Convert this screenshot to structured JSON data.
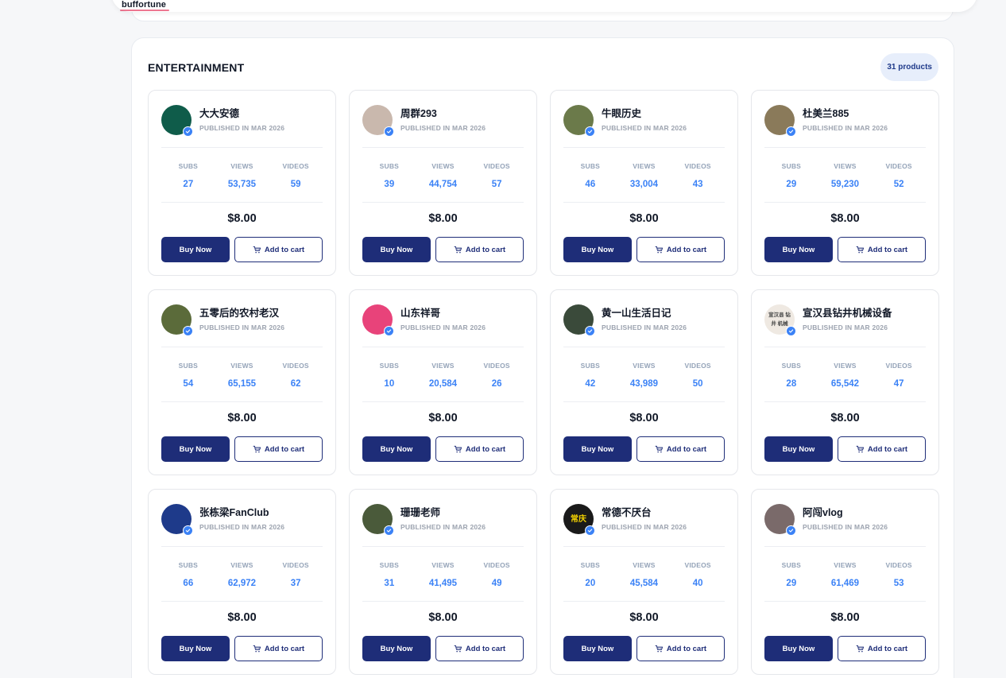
{
  "header": {
    "logo_text": "buffortune"
  },
  "section": {
    "title": "ENTERTAINMENT",
    "count_badge": "31 products"
  },
  "labels": {
    "subs": "SUBS",
    "views": "VIEWS",
    "videos": "VIDEOS",
    "buy_now": "Buy Now",
    "add_to_cart": "Add to cart"
  },
  "colors": {
    "primary": "#1e2d78",
    "accent_blue": "#3b82f6",
    "badge_bg": "#e7eefb"
  },
  "products": [
    {
      "name": "大大安德",
      "published": "PUBLISHED IN MAR 2026",
      "subs": "27",
      "views": "53,735",
      "videos": "59",
      "price": "$8.00",
      "avatar_color": "#0f5c4a"
    },
    {
      "name": "周群293",
      "published": "PUBLISHED IN MAR 2026",
      "subs": "39",
      "views": "44,754",
      "videos": "57",
      "price": "$8.00",
      "avatar_color": "#c9b8ad"
    },
    {
      "name": "牛眼历史",
      "published": "PUBLISHED IN MAR 2026",
      "subs": "46",
      "views": "33,004",
      "videos": "43",
      "price": "$8.00",
      "avatar_color": "#6b7a4a"
    },
    {
      "name": "杜美兰885",
      "published": "PUBLISHED IN MAR 2026",
      "subs": "29",
      "views": "59,230",
      "videos": "52",
      "price": "$8.00",
      "avatar_color": "#8a7a5a"
    },
    {
      "name": "五零后的农村老汉",
      "published": "PUBLISHED IN MAR 2026",
      "subs": "54",
      "views": "65,155",
      "videos": "62",
      "price": "$8.00",
      "avatar_color": "#5b6b3a"
    },
    {
      "name": "山东祥哥",
      "published": "PUBLISHED IN MAR 2026",
      "subs": "10",
      "views": "20,584",
      "videos": "26",
      "price": "$8.00",
      "avatar_color": "#e8437a"
    },
    {
      "name": "黄一山生活日记",
      "published": "PUBLISHED IN MAR 2026",
      "subs": "42",
      "views": "43,989",
      "videos": "50",
      "price": "$8.00",
      "avatar_color": "#3a4a3a"
    },
    {
      "name": "宣汉县钻井机械设备",
      "published": "PUBLISHED IN MAR 2026",
      "subs": "28",
      "views": "65,542",
      "videos": "47",
      "price": "$8.00",
      "avatar_color": "#efe9e2",
      "avatar_text": "宣汉县 钻井 机械"
    },
    {
      "name": "张栋梁FanClub",
      "published": "PUBLISHED IN MAR 2026",
      "subs": "66",
      "views": "62,972",
      "videos": "37",
      "price": "$8.00",
      "avatar_color": "#1e3a8a"
    },
    {
      "name": "珊珊老师",
      "published": "PUBLISHED IN MAR 2026",
      "subs": "31",
      "views": "41,495",
      "videos": "49",
      "price": "$8.00",
      "avatar_color": "#4a5a3a"
    },
    {
      "name": "常德不厌台",
      "published": "PUBLISHED IN MAR 2026",
      "subs": "20",
      "views": "45,584",
      "videos": "40",
      "price": "$8.00",
      "avatar_color": "#1a1a1a",
      "avatar_text": "常庆"
    },
    {
      "name": "阿闯vlog",
      "published": "PUBLISHED IN MAR 2026",
      "subs": "29",
      "views": "61,469",
      "videos": "53",
      "price": "$8.00",
      "avatar_color": "#7a6a6a"
    }
  ]
}
